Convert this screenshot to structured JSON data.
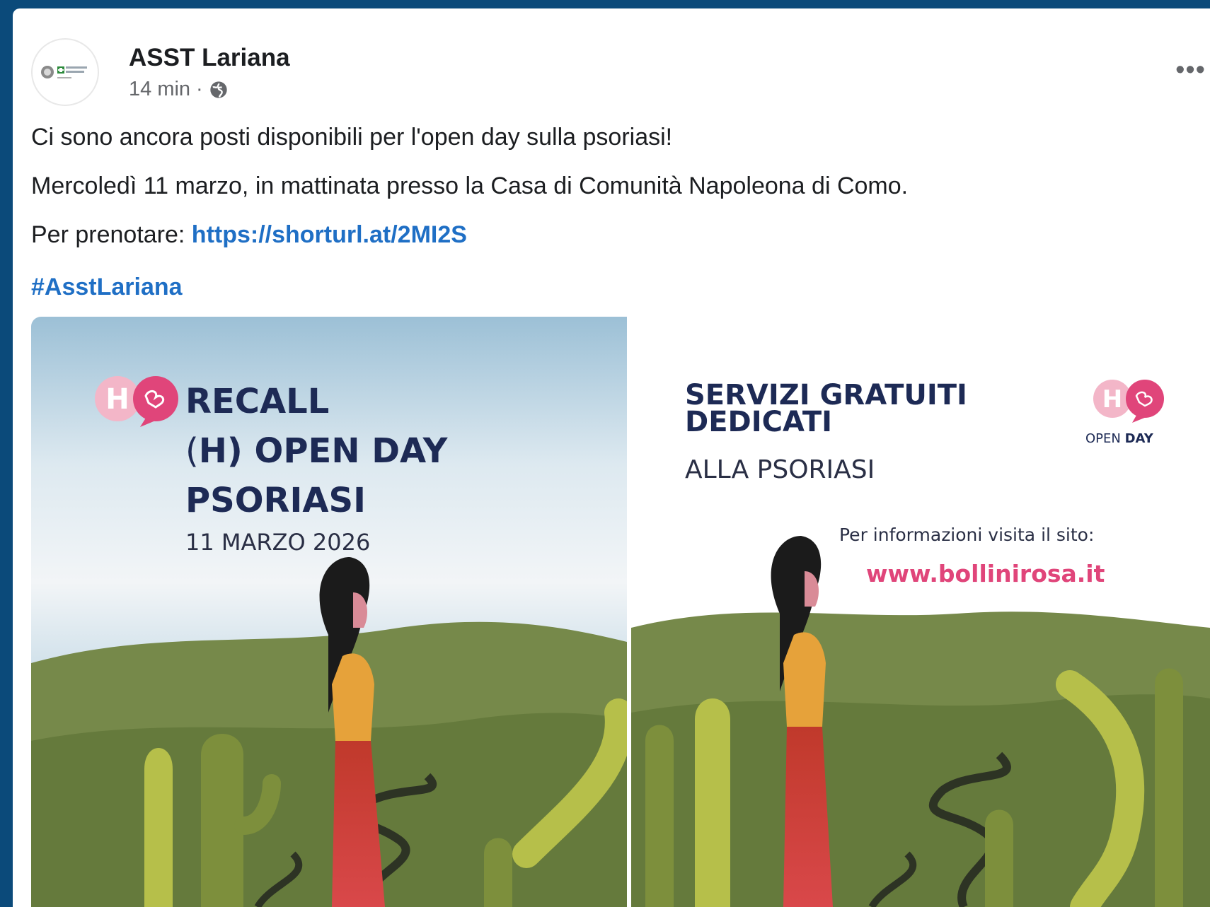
{
  "post": {
    "author": "ASST Lariana",
    "time": "14 min",
    "audience_icon": "globe-icon",
    "more_icon": "more-options-icon",
    "line1": "Ci sono ancora posti disponibili per l'open day sulla psoriasi!",
    "line2": "Mercoledì 11 marzo, in mattinata presso la Casa di Comunità Napoleona di Como.",
    "line3_prefix": "Per prenotare: ",
    "link": "https://shorturl.at/2MI2S",
    "hashtag": "#AsstLariana"
  },
  "left_image": {
    "h_badge": "H",
    "title_line1": "RECALL",
    "title_line2_open": "(",
    "title_line2_h": "H",
    "title_line2_rest": ") OPEN DAY",
    "title_line3": "PSORIASI",
    "date": "11 MARZO 2026"
  },
  "right_image": {
    "h_badge": "H",
    "open_label": "OPEN",
    "day_label": "DAY",
    "title_line1": "SERVIZI GRATUITI",
    "title_line2": "DEDICATI",
    "subtitle": "ALLA PSORIASI",
    "info": "Per informazioni visita il sito:",
    "site": "www.bollinirosa.it"
  },
  "colors": {
    "page_border": "#0b4a7a",
    "link": "#1f6fc5",
    "poster_navy": "#1d2a55",
    "poster_pink": "#e0457a",
    "hill_green": "#6b7f3a"
  }
}
